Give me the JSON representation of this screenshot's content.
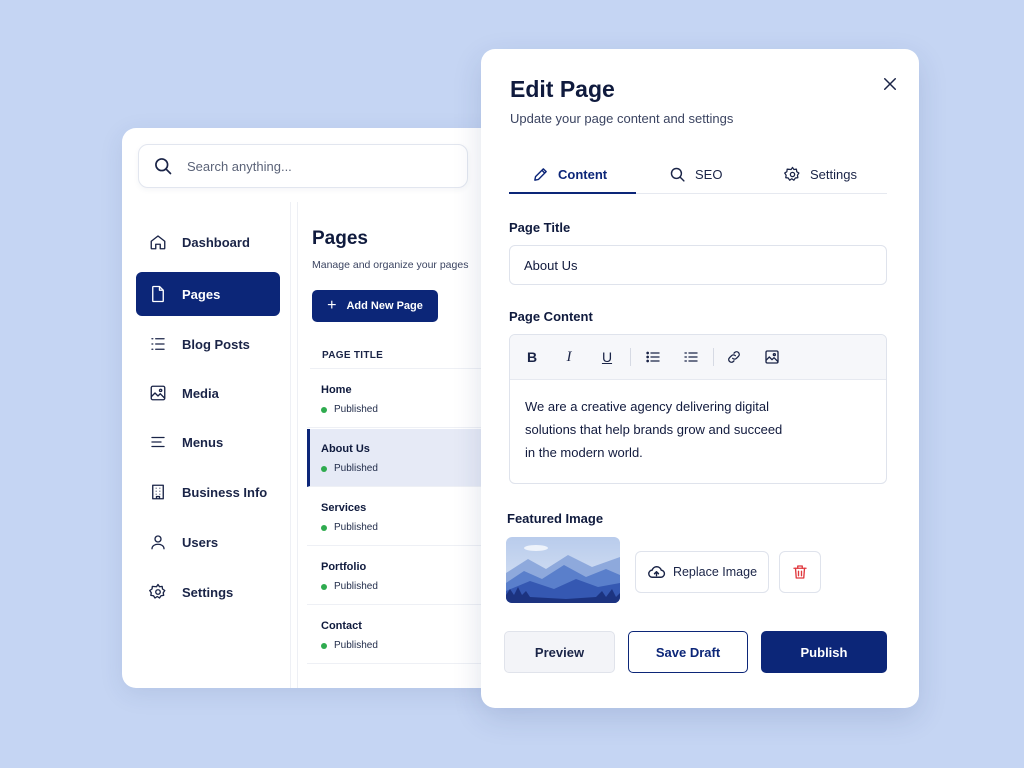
{
  "search": {
    "placeholder": "Search anything..."
  },
  "sidebar": {
    "items": [
      {
        "label": "Dashboard",
        "icon": "home-icon",
        "active": false
      },
      {
        "label": "Pages",
        "icon": "document-icon",
        "active": true
      },
      {
        "label": "Blog Posts",
        "icon": "list-icon",
        "active": false
      },
      {
        "label": "Media",
        "icon": "image-icon",
        "active": false
      },
      {
        "label": "Menus",
        "icon": "menu-lines-icon",
        "active": false
      },
      {
        "label": "Business Info",
        "icon": "building-icon",
        "active": false
      },
      {
        "label": "Users",
        "icon": "user-icon",
        "active": false
      },
      {
        "label": "Settings",
        "icon": "gear-icon",
        "active": false
      }
    ]
  },
  "pages": {
    "title": "Pages",
    "subtitle": "Manage and organize your pages",
    "add_label": "Add New Page",
    "column_header": "PAGE TITLE",
    "rows": [
      {
        "name": "Home",
        "status": "Published"
      },
      {
        "name": "About Us",
        "status": "Published"
      },
      {
        "name": "Services",
        "status": "Published"
      },
      {
        "name": "Portfolio",
        "status": "Published"
      },
      {
        "name": "Contact",
        "status": "Published"
      }
    ]
  },
  "modal": {
    "title": "Edit Page",
    "subtitle": "Update your page content and settings",
    "tabs": [
      {
        "label": "Content",
        "icon": "pencil-icon"
      },
      {
        "label": "SEO",
        "icon": "search-icon"
      },
      {
        "label": "Settings",
        "icon": "gear-icon"
      }
    ],
    "page_title_label": "Page Title",
    "page_title_value": "About Us",
    "page_content_label": "Page Content",
    "page_content_lines": [
      "We are a creative agency delivering digital",
      "solutions that help brands grow and succeed",
      "in the modern world."
    ],
    "toolbar": {
      "bold": "B",
      "italic": "I",
      "underline": "U"
    },
    "featured_image_label": "Featured Image",
    "replace_label": "Replace Image",
    "preview_label": "Preview",
    "save_draft_label": "Save Draft",
    "publish_label": "Publish"
  },
  "colors": {
    "background": "#c5d5f3",
    "primary": "#0c2678",
    "status_green": "#2fab4f",
    "danger": "#e0383e"
  }
}
